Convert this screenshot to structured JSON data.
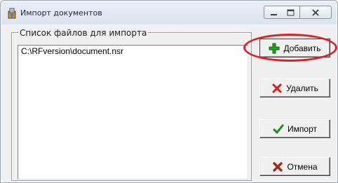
{
  "window": {
    "title": "Импорт документов",
    "icon": "import-docs-icon"
  },
  "files_group": {
    "legend": "Список файлов для импорта",
    "files": [
      "C:\\RFversion\\document.nsr"
    ]
  },
  "buttons": {
    "add": "Добавить",
    "delete": "Удалить",
    "import": "Импорт",
    "cancel": "Отмена"
  },
  "colors": {
    "add_icon": "#1aa318",
    "delete_icon": "#d81b1b",
    "import_icon": "#1b8d1b",
    "cancel_icon": "#a52a1b",
    "annotation": "#e02026"
  }
}
